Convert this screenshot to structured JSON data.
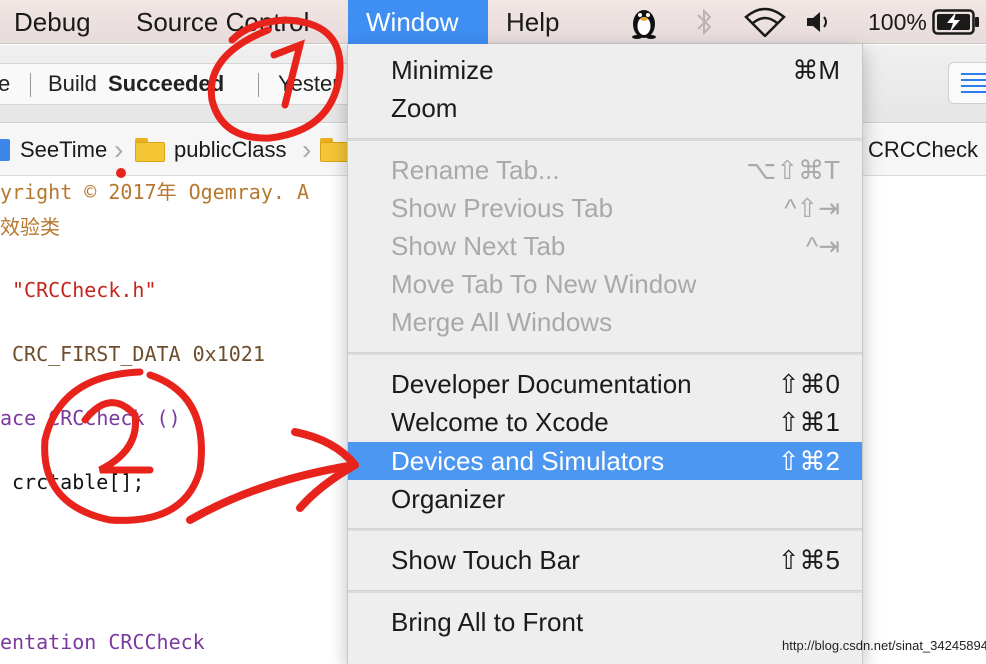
{
  "menubar": {
    "items": [
      {
        "label": "Debug"
      },
      {
        "label": "Source Control"
      },
      {
        "label": "Window",
        "active": true
      },
      {
        "label": "Help"
      }
    ],
    "battery": "100%",
    "status_icons": [
      "qq-penguin-icon",
      "bluetooth-icon",
      "wifi-icon",
      "volume-icon",
      "battery-charging-icon"
    ]
  },
  "toolbar": {
    "status_prefix": "e",
    "status_build": "Build",
    "status_result": "Succeeded",
    "status_trailing": "Yester"
  },
  "jumpbar": {
    "crumbs": [
      "SeeTime",
      "publicClass"
    ],
    "right_file": "CRCCheck"
  },
  "code": {
    "lines": [
      "yright © 2017年 Ogemray. A",
      "效验类",
      "\"CRCCheck.h\"",
      "CRC_FIRST_DATA 0x1021",
      "ace CRCCheck ()",
      "crctable[];",
      "entation CRCCheck"
    ]
  },
  "window_menu": {
    "groups": [
      [
        {
          "label": "Minimize",
          "shortcut": "⌘M",
          "enabled": true
        },
        {
          "label": "Zoom",
          "shortcut": "",
          "enabled": true
        }
      ],
      [
        {
          "label": "Rename Tab...",
          "shortcut": "⌥⇧⌘T",
          "enabled": false
        },
        {
          "label": "Show Previous Tab",
          "shortcut": "^⇧⇥",
          "enabled": false
        },
        {
          "label": "Show Next Tab",
          "shortcut": "^⇥",
          "enabled": false
        },
        {
          "label": "Move Tab To New Window",
          "shortcut": "",
          "enabled": false
        },
        {
          "label": "Merge All Windows",
          "shortcut": "",
          "enabled": false
        }
      ],
      [
        {
          "label": "Developer Documentation",
          "shortcut": "⇧⌘0",
          "enabled": true
        },
        {
          "label": "Welcome to Xcode",
          "shortcut": "⇧⌘1",
          "enabled": true
        },
        {
          "label": "Devices and Simulators",
          "shortcut": "⇧⌘2",
          "enabled": true,
          "highlighted": true
        },
        {
          "label": "Organizer",
          "shortcut": "",
          "enabled": true
        }
      ],
      [
        {
          "label": "Show Touch Bar",
          "shortcut": "⇧⌘5",
          "enabled": true
        }
      ],
      [
        {
          "label": "Bring All to Front",
          "shortcut": "",
          "enabled": true
        }
      ]
    ]
  },
  "annotations": {
    "marks": [
      "1",
      "2"
    ],
    "color": "#e8231c"
  },
  "watermark": "http://blog.csdn.net/sinat_34245894",
  "colors": {
    "menu_highlight": "#4c97f2",
    "menubar_active": "#3f8ef3",
    "annotation_red": "#e8231c"
  }
}
